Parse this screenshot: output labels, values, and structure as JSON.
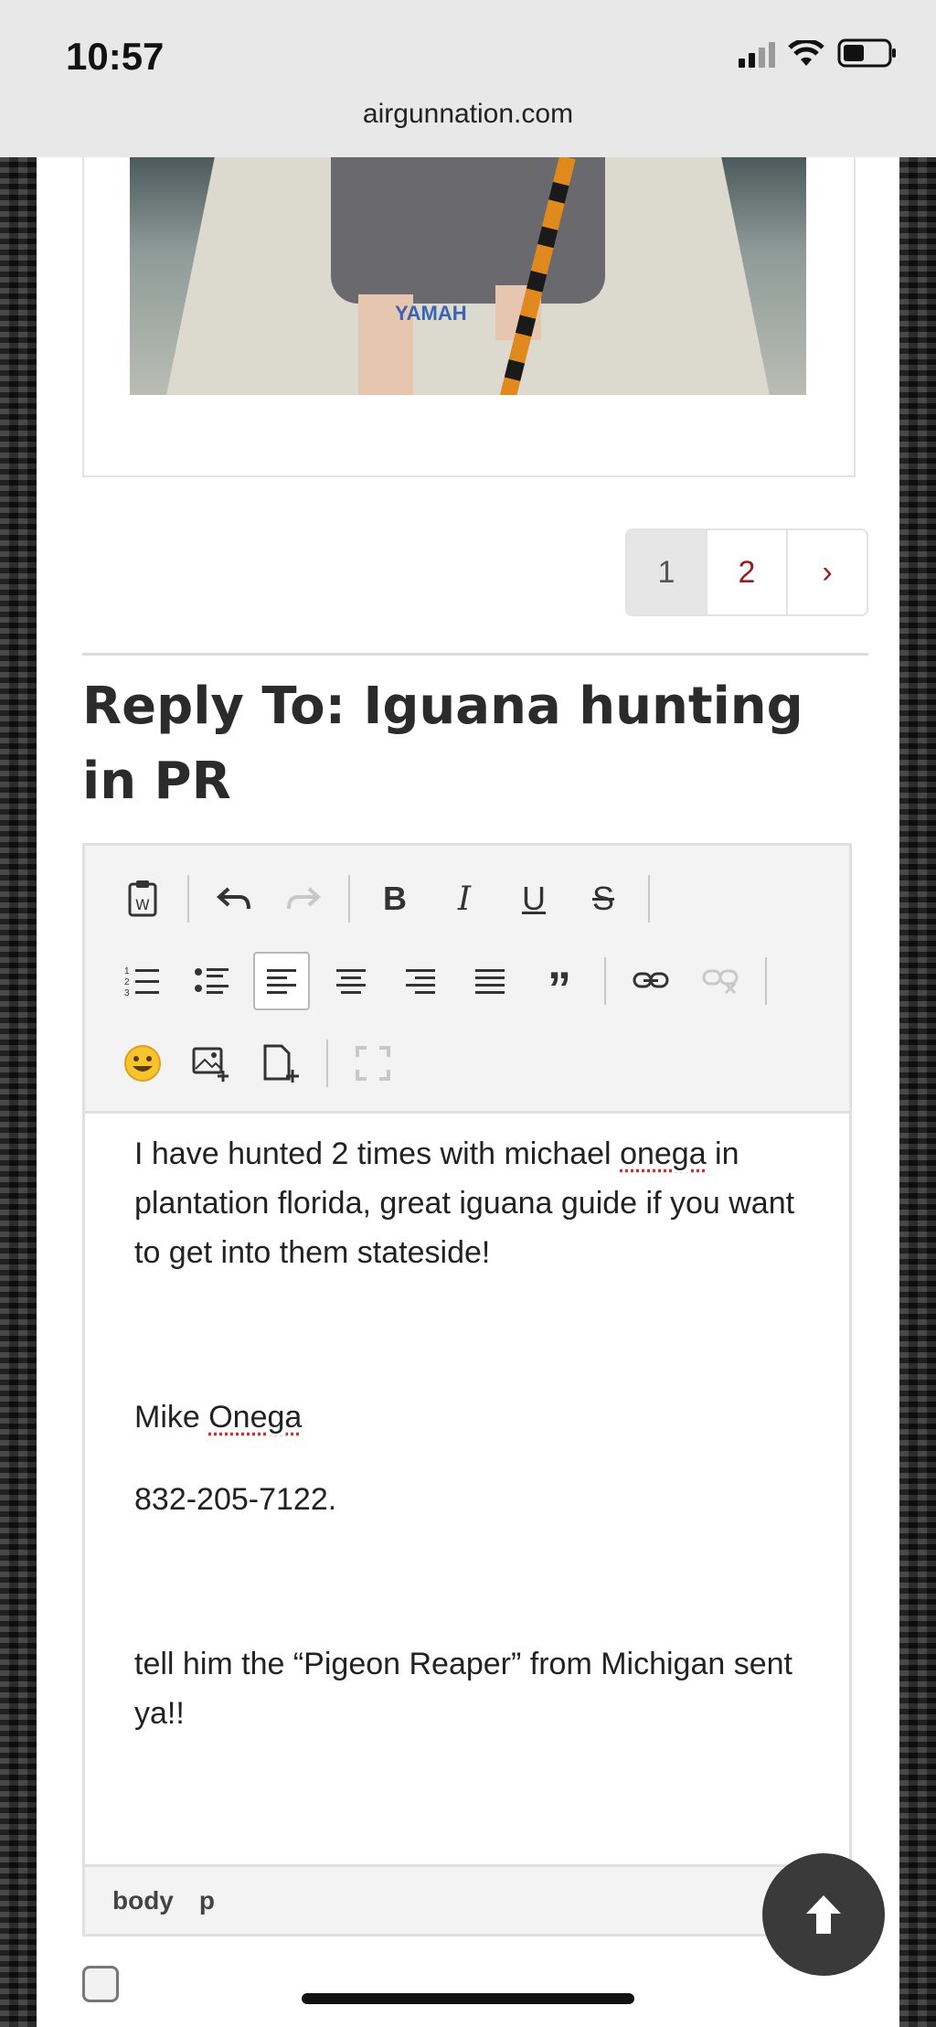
{
  "status_bar": {
    "time": "10:57",
    "url": "airgunnation.com"
  },
  "post_image": {
    "logo_text": "YAMAH"
  },
  "pagination": {
    "pages": [
      "1",
      "2"
    ],
    "next": "›",
    "current": "1"
  },
  "reply": {
    "title": "Reply To: Iguana hunting in PR"
  },
  "editor": {
    "content": {
      "p1_a": "I have hunted 2 times with michael ",
      "p1_b": "onega",
      "p1_c": " in plantation florida, great iguana guide if you want to get into them stateside!",
      "p2_a": "Mike ",
      "p2_b": "Onega",
      "p3": "832-205-7122.",
      "p4": "tell him the “Pigeon Reaper” from Michigan sent ya!!"
    },
    "path": [
      "body",
      "p"
    ]
  },
  "icons": {
    "toolbar_row1": [
      "paste-word-icon",
      "undo-icon",
      "redo-icon",
      "bold-icon",
      "italic-icon",
      "underline-icon",
      "strikethrough-icon"
    ],
    "toolbar_row2": [
      "numbered-list-icon",
      "bullet-list-icon",
      "align-left-icon",
      "align-center-icon",
      "align-right-icon",
      "justify-icon",
      "blockquote-icon",
      "link-icon",
      "unlink-icon"
    ],
    "toolbar_row3": [
      "emoji-icon",
      "insert-image-icon",
      "insert-file-icon",
      "fullscreen-icon"
    ],
    "scroll": "arrow-up-icon"
  },
  "colors": {
    "link_red": "#9b1c1c",
    "title": "#2b2b2b"
  }
}
